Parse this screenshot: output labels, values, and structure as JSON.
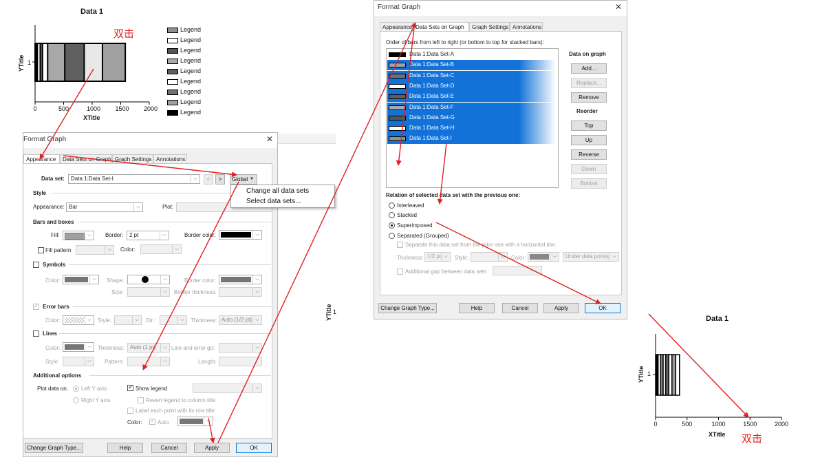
{
  "annotation_colors": {
    "arrow": "#e02020"
  },
  "top_chart": {
    "title": "Data 1",
    "ylabel": "YTitle",
    "xlabel": "XTitle",
    "ytick": "1",
    "xticks": [
      "0",
      "500",
      "1000",
      "1500",
      "2000"
    ],
    "legend_label": "Legend",
    "annotation": "双击"
  },
  "bottom_chart": {
    "title": "Data 1",
    "ylabel": "YTitle",
    "xlabel": "XTitle",
    "ytick": "1",
    "xticks": [
      "0",
      "500",
      "1000",
      "1500",
      "2000"
    ],
    "annotation": "双击"
  },
  "chart_data": [
    {
      "type": "bar",
      "title": "Data 1",
      "xlabel": "XTitle",
      "ylabel": "YTitle",
      "xlim": [
        0,
        2000
      ],
      "categories": [
        "1"
      ],
      "layout": "superimposed",
      "series": [
        {
          "values": [
            1580
          ],
          "color": "#a0a0a0"
        },
        {
          "values": [
            1180
          ],
          "color": "#e8e8e8"
        },
        {
          "values": [
            860
          ],
          "color": "#606060"
        },
        {
          "values": [
            520
          ],
          "color": "#a8a8a8"
        },
        {
          "values": [
            220
          ],
          "color": "#ffffff"
        },
        {
          "values": [
            130
          ],
          "color": "#707070"
        },
        {
          "values": [
            90
          ],
          "color": "#ffffff"
        },
        {
          "values": [
            40
          ],
          "color": "#000000"
        }
      ],
      "legend": {
        "placement": "right",
        "entries": 9
      }
    },
    {
      "type": "bar",
      "title": "Data 1",
      "xlabel": "XTitle",
      "ylabel": "YTitle",
      "xlim": [
        0,
        2000
      ],
      "categories": [
        "1"
      ],
      "layout": "stacked",
      "series": [
        {
          "values": [
            40
          ],
          "color": "#000000"
        },
        {
          "values": [
            40
          ],
          "color": "#ffffff"
        },
        {
          "values": [
            40
          ],
          "color": "#888888"
        },
        {
          "values": [
            40
          ],
          "color": "#ffffff"
        },
        {
          "values": [
            50
          ],
          "color": "#666666"
        },
        {
          "values": [
            50
          ],
          "color": "#ffffff"
        },
        {
          "values": [
            60
          ],
          "color": "#999999"
        },
        {
          "values": [
            60
          ],
          "color": "#ffffff"
        }
      ]
    }
  ],
  "mid_ytitle": {
    "label": "YTitle",
    "tick": "1"
  },
  "left_dialog": {
    "title": "Format Graph",
    "tabs": [
      "Appearance",
      "Data Sets on Graph",
      "Graph Settings",
      "Annotations"
    ],
    "data_set_label": "Data set:",
    "data_set_value": "Data 1:Data Set-I",
    "prev_btn": "<",
    "next_btn": ">",
    "global_btn": "Global",
    "style_header": "Style",
    "appearance_label": "Appearance:",
    "appearance_value": "Bar",
    "plot_label": "Plot:",
    "bars_header": "Bars and boxes",
    "fill_label": "Fill:",
    "border_label": "Border:",
    "border_value": "2 pt",
    "border_color_label": "Border color:",
    "fill_pattern_label": "Fill pattern",
    "color_label": "Color:",
    "symbols_header": "Symbols",
    "shape_label": "Shape:",
    "size_label": "Size:",
    "border_thickness_label": "Border thickness:",
    "error_bars_header": "Error bars",
    "style_label": "Style:",
    "dir_label": "Dir.:",
    "thickness_label": "Thickness:",
    "thickness_value": "Auto (1/2 pt)",
    "lines_header": "Lines",
    "lines_thickness_value": "Auto (1 pt)",
    "line_error_label": "Line and error go:",
    "pattern_label": "Pattern:",
    "length_label": "Length:",
    "additional_header": "Additional options",
    "plot_data_on": "Plot data on:",
    "left_y_axis": "Left Y axis",
    "right_y_axis": "Right  Y axis",
    "show_legend": "Show legend",
    "revert_legend": "Revert legend to column title",
    "label_each_point": "Label each point with its row title",
    "auto_label": "Auto",
    "buttons": {
      "change_type": "Change Graph Type...",
      "help": "Help",
      "cancel": "Cancel",
      "apply": "Apply",
      "ok": "OK"
    }
  },
  "global_menu": {
    "items": [
      "Change all data sets",
      "Select data sets..."
    ]
  },
  "right_dialog": {
    "title": "Format Graph",
    "tabs": [
      "Appearance",
      "Data Sets on Graph",
      "Graph Settings",
      "Annotations"
    ],
    "order_label": "Order of bars from left to right (or bottom to top for stacked bars):",
    "datasets": [
      {
        "name": "Data 1:Data Set-A",
        "selected": false,
        "color": "#000000"
      },
      {
        "name": "Data 1:Data Set-B",
        "selected": true,
        "color": "#a0a0a0"
      },
      {
        "name": "Data 1:Data Set-C",
        "selected": true,
        "color": "#707070"
      },
      {
        "name": "Data 1:Data Set-D",
        "selected": true,
        "color": "#ffffff"
      },
      {
        "name": "Data 1:Data Set-E",
        "selected": true,
        "color": "#606060"
      },
      {
        "name": "Data 1:Data Set-F",
        "selected": true,
        "color": "#a8a8a8"
      },
      {
        "name": "Data 1:Data Set-G",
        "selected": true,
        "color": "#555555"
      },
      {
        "name": "Data 1:Data Set-H",
        "selected": true,
        "color": "#ffffff"
      },
      {
        "name": "Data 1:Data Set-I",
        "selected": true,
        "color": "#909090"
      }
    ],
    "data_on_graph": "Data on graph",
    "add_btn": "Add...",
    "replace_btn": "Replace...",
    "remove_btn": "Remove",
    "reorder": "Reorder",
    "top_btn": "Top",
    "up_btn": "Up",
    "reverse_btn": "Reverse",
    "down_btn": "Down",
    "bottom_btn": "Bottom",
    "relation_label": "Relation of selected data set with the previous one:",
    "interleaved": "Interleaved",
    "stacked": "Stacked",
    "superimposed": "Superimposed",
    "separated": "Separated (Grouped)",
    "separate_line": "Separate this data set from the prior one with a horizontal line.",
    "thickness_label": "Thickness:",
    "thickness_value": "1/2 pt",
    "style_label": "Style:",
    "color_label": "Color:",
    "under_points": "Under data points",
    "additional_gap": "Additional gap between data sets",
    "buttons": {
      "change_type": "Change Graph Type...",
      "help": "Help",
      "cancel": "Cancel",
      "apply": "Apply",
      "ok": "OK"
    }
  }
}
